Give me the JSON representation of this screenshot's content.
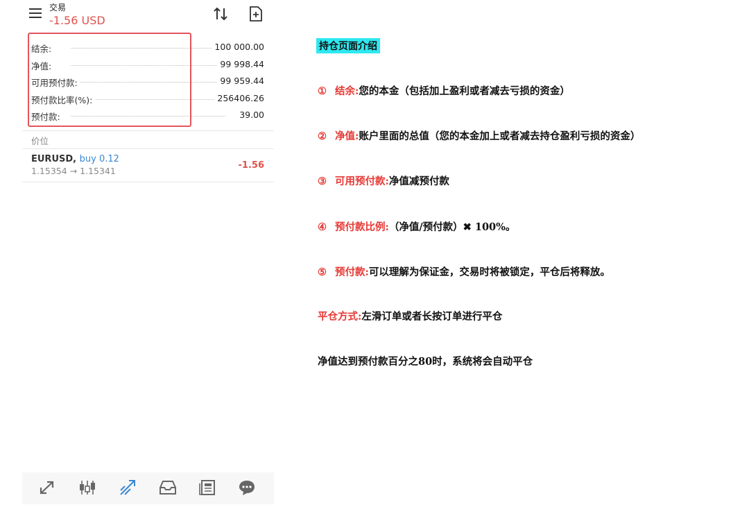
{
  "header": {
    "title": "交易",
    "profit": "-1.56 USD"
  },
  "summary": [
    {
      "label": "结余:",
      "value": "100 000.00"
    },
    {
      "label": "净值:",
      "value": "99 998.44"
    },
    {
      "label": "可用预付款:",
      "value": "99 959.44"
    },
    {
      "label": "预付款比率(%):",
      "value": "256406.26"
    },
    {
      "label": "预付款:",
      "value": "39.00"
    }
  ],
  "positions_section": "价位",
  "position": {
    "symbol": "EURUSD,",
    "direction": "buy 0.12",
    "prices": "1.15354 → 1.15341",
    "profit": "-1.56"
  },
  "bottom_nav": [
    "quotes-icon",
    "chart-icon",
    "trade-icon",
    "history-icon",
    "news-icon",
    "chat-icon"
  ],
  "annotations": {
    "title": "持仓页面介绍",
    "items": [
      {
        "num": "①",
        "key": "结余:",
        "text": "您的本金（包括加上盈利或者减去亏损的资金）"
      },
      {
        "num": "②",
        "key": "净值:",
        "text": "账户里面的总值（您的本金加上或者减去持仓盈利亏损的资金）"
      },
      {
        "num": "③",
        "key": "可用预付款:",
        "text": "净值减预付款"
      },
      {
        "num": "④",
        "key": "预付款比例:",
        "text": "（净值/预付款）✖  100%。"
      },
      {
        "num": "⑤",
        "key": "预付款:",
        "text": "可以理解为保证金，交易时将被锁定，平仓后将释放。"
      }
    ],
    "close_method_key": "平仓方式:",
    "close_method_text": "左滑订单或者长按订单进行平仓",
    "auto_close": "净值达到预付款百分之80时，系统将会自动平仓"
  },
  "colors": {
    "loss": "#e0524d",
    "accent": "#3a86d3",
    "highlight": "#e4545a",
    "title_bg": "#2ee8f0"
  }
}
